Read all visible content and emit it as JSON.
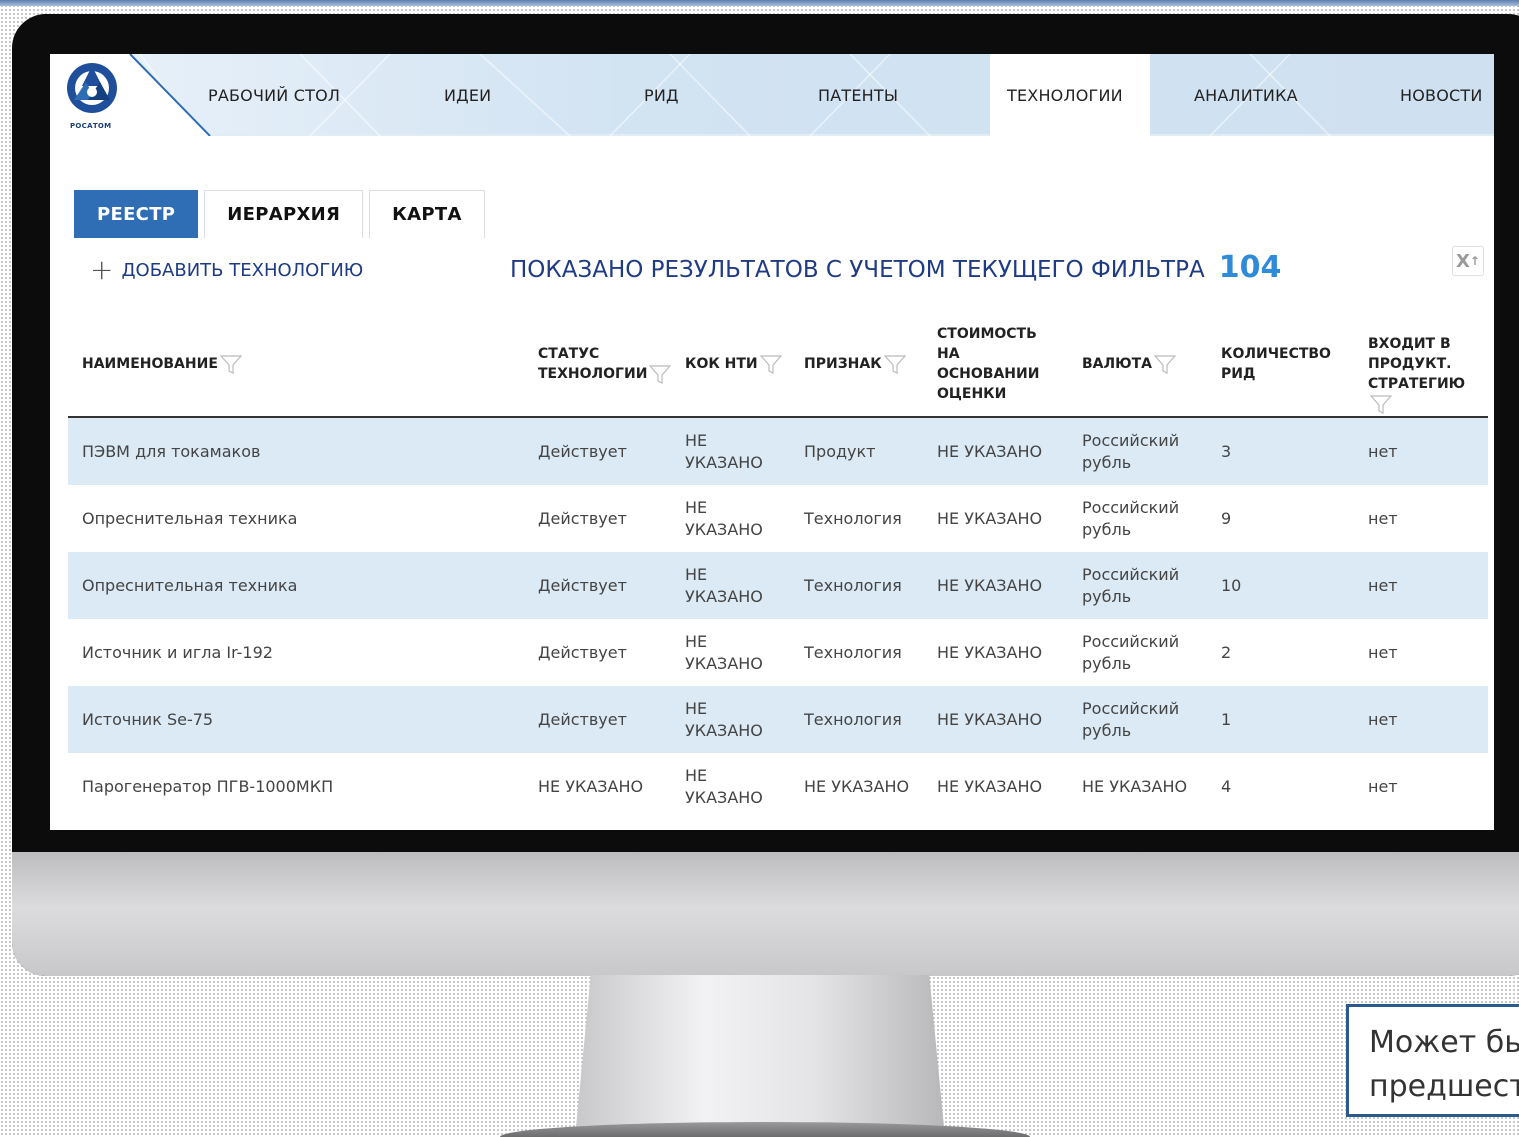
{
  "logo": {
    "text": "РОСАТОМ"
  },
  "nav": {
    "items": [
      {
        "label": "РАБОЧИЙ СТОЛ",
        "active": false
      },
      {
        "label": "ИДЕИ",
        "active": false
      },
      {
        "label": "РИД",
        "active": false
      },
      {
        "label": "ПАТЕНТЫ",
        "active": false
      },
      {
        "label": "ТЕХНОЛОГИИ",
        "active": true
      },
      {
        "label": "АНАЛИТИКА",
        "active": false
      },
      {
        "label": "НОВОСТИ",
        "active": false
      }
    ]
  },
  "tabs": [
    {
      "label": "РЕЕСТР",
      "active": true
    },
    {
      "label": "ИЕРАРХИЯ",
      "active": false
    },
    {
      "label": "КАРТА",
      "active": false
    }
  ],
  "toolbar": {
    "add_label": "ДОБАВИТЬ ТЕХНОЛОГИЮ",
    "results_label": "ПОКАЗАНО РЕЗУЛЬТАТОВ С УЧЕТОМ ТЕКУЩЕГО ФИЛЬТРА",
    "results_count": "104",
    "export_icon": "excel-export-icon"
  },
  "table": {
    "columns": [
      {
        "label": "НАИМЕНОВАНИЕ",
        "filter": true
      },
      {
        "label": "СТАТУС ТЕХНОЛОГИИ",
        "filter": true
      },
      {
        "label": "КОК НТИ",
        "filter": true
      },
      {
        "label": "ПРИЗНАК",
        "filter": true
      },
      {
        "label": "СТОИМОСТЬ НА ОСНОВАНИИ ОЦЕНКИ",
        "filter": false
      },
      {
        "label": "ВАЛЮТА",
        "filter": true
      },
      {
        "label": "КОЛИЧЕСТВО РИД",
        "filter": false
      },
      {
        "label": "ВХОДИТ В ПРОДУКТ. СТРАТЕГИЮ",
        "filter": true
      }
    ],
    "rows": [
      [
        "ПЭВМ для токамаков",
        "Действует",
        "НЕ УКАЗАНО",
        "Продукт",
        "НЕ УКАЗАНО",
        "Российский рубль",
        "3",
        "нет"
      ],
      [
        "Опреснительная техника",
        "Действует",
        "НЕ УКАЗАНО",
        "Технология",
        "НЕ УКАЗАНО",
        "Российский рубль",
        "9",
        "нет"
      ],
      [
        "Опреснительная техника",
        "Действует",
        "НЕ УКАЗАНО",
        "Технология",
        "НЕ УКАЗАНО",
        "Российский рубль",
        "10",
        "нет"
      ],
      [
        "Источник и игла Ir-192",
        "Действует",
        "НЕ УКАЗАНО",
        "Технология",
        "НЕ УКАЗАНО",
        "Российский рубль",
        "2",
        "нет"
      ],
      [
        "Источник Se-75",
        "Действует",
        "НЕ УКАЗАНО",
        "Технология",
        "НЕ УКАЗАНО",
        "Российский рубль",
        "1",
        "нет"
      ],
      [
        "Парогенератор ПГВ-1000МКП",
        "НЕ УКАЗАНО",
        "НЕ УКАЗАНО",
        "НЕ УКАЗАНО",
        "НЕ УКАЗАНО",
        "НЕ УКАЗАНО",
        "4",
        "нет"
      ]
    ]
  },
  "note": {
    "line1": "Может бы",
    "line2": "предшест"
  },
  "colors": {
    "accent": "#2f6eb4",
    "title": "#1f3b84",
    "count": "#2f8ad8",
    "row_alt": "#dbeaf5"
  }
}
